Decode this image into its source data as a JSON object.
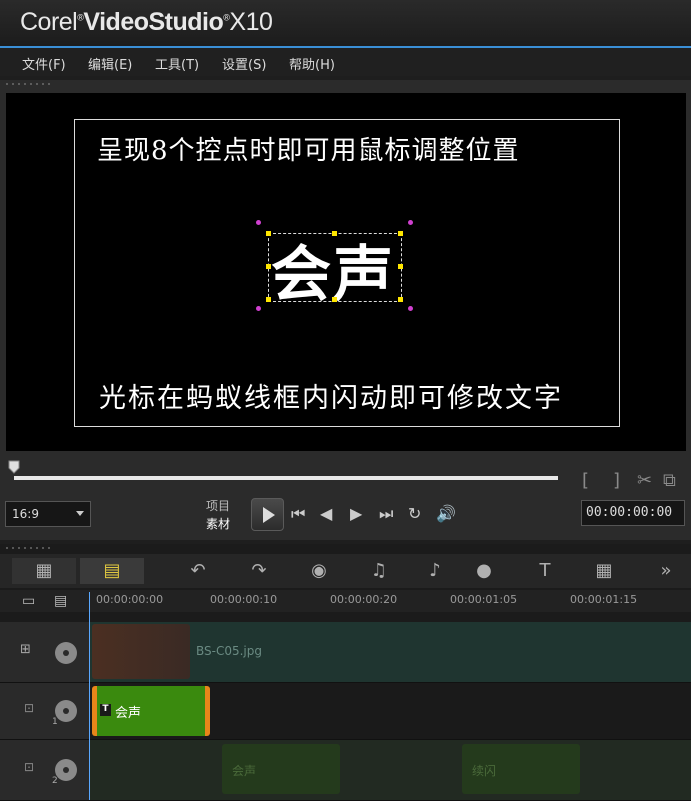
{
  "app": {
    "brand_prefix": "Corel",
    "brand_main": "VideoStudio",
    "brand_version": "X10"
  },
  "menu": [
    {
      "label": "文件(F)"
    },
    {
      "label": "编辑(E)"
    },
    {
      "label": "工具(T)"
    },
    {
      "label": "设置(S)"
    },
    {
      "label": "帮助(H)"
    }
  ],
  "preview": {
    "caption_top": "呈现8个控点时即可用鼠标调整位置",
    "title_text": "会声",
    "caption_bottom": "光标在蚂蚁线框内闪动即可修改文字"
  },
  "player": {
    "aspect_ratio": "16:9",
    "mode_project": "项目",
    "mode_clip": "素材",
    "timecode": "00:00:00:00"
  },
  "timeline": {
    "ruler": [
      "00:00:00:00",
      "00:00:00:10",
      "00:00:00:20",
      "00:00:01:05",
      "00:00:01:15"
    ],
    "video_clip_label": "BS-C05.jpg",
    "title_clip_label": "会声",
    "track1_number": "1",
    "track2_number": "2",
    "track2_clips": [
      "会声",
      "续闪"
    ]
  },
  "colors": {
    "accent": "#3a8fd6",
    "title_clip": "#3a8a0e",
    "handle": "#ffe600",
    "rotate_handle": "#d040d0"
  }
}
